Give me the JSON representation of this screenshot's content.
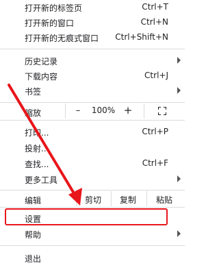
{
  "menu": {
    "new_tab": {
      "label": "打开新的标签页",
      "shortcut": "Ctrl+T"
    },
    "new_window": {
      "label": "打开新的窗口",
      "shortcut": "Ctrl+N"
    },
    "new_incognito": {
      "label": "打开新的无痕式窗口",
      "shortcut": "Ctrl+Shift+N"
    },
    "history": {
      "label": "历史记录"
    },
    "downloads": {
      "label": "下载内容",
      "shortcut": "Ctrl+J"
    },
    "bookmarks": {
      "label": "书签"
    },
    "zoom": {
      "label": "缩放",
      "minus": "–",
      "value": "100%",
      "plus": "+"
    },
    "print": {
      "label": "打印...",
      "shortcut": "Ctrl+P"
    },
    "cast": {
      "label": "投射..."
    },
    "find": {
      "label": "查找...",
      "shortcut": "Ctrl+F"
    },
    "more_tools": {
      "label": "更多工具"
    },
    "edit": {
      "label": "编辑",
      "cut": "剪切",
      "copy": "复制",
      "paste": "粘贴"
    },
    "settings": {
      "label": "设置"
    },
    "help": {
      "label": "帮助"
    },
    "exit": {
      "label": "退出"
    }
  },
  "annotation": {
    "color": "#e8161b"
  }
}
